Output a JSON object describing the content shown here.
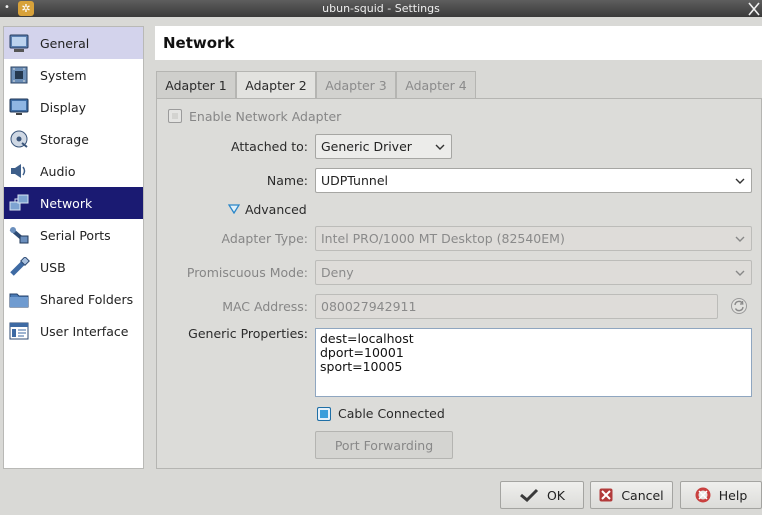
{
  "window": {
    "title": "ubun-squid - Settings"
  },
  "sidebar": {
    "items": [
      {
        "label": "General",
        "icon": "general-icon"
      },
      {
        "label": "System",
        "icon": "system-icon"
      },
      {
        "label": "Display",
        "icon": "display-icon"
      },
      {
        "label": "Storage",
        "icon": "storage-icon"
      },
      {
        "label": "Audio",
        "icon": "audio-icon"
      },
      {
        "label": "Network",
        "icon": "network-icon"
      },
      {
        "label": "Serial Ports",
        "icon": "serial-ports-icon"
      },
      {
        "label": "USB",
        "icon": "usb-icon"
      },
      {
        "label": "Shared Folders",
        "icon": "shared-folders-icon"
      },
      {
        "label": "User Interface",
        "icon": "user-interface-icon"
      }
    ],
    "selected": "Network",
    "hovered": "General"
  },
  "header": {
    "title": "Network"
  },
  "tabs": [
    {
      "label": "Adapter 1",
      "state": "normal"
    },
    {
      "label": "Adapter 2",
      "state": "selected"
    },
    {
      "label": "Adapter 3",
      "state": "disabled"
    },
    {
      "label": "Adapter 4",
      "state": "disabled"
    }
  ],
  "form": {
    "enable_label": "Enable Network Adapter",
    "attached_label": "Attached to:",
    "attached_value": "Generic Driver",
    "name_label": "Name:",
    "name_value": "UDPTunnel",
    "advanced_label": "Advanced",
    "adapter_type_label": "Adapter Type:",
    "adapter_type_value": "Intel PRO/1000 MT Desktop (82540EM)",
    "promiscuous_label": "Promiscuous Mode:",
    "promiscuous_value": "Deny",
    "mac_label": "MAC Address:",
    "mac_value": "080027942911",
    "generic_props_label": "Generic Properties:",
    "generic_props_lines": [
      "dest=localhost",
      "dport=10001",
      "sport=10005"
    ],
    "cable_label": "Cable Connected",
    "cable_checked": true,
    "port_forwarding_label": "Port Forwarding"
  },
  "buttons": {
    "ok": "OK",
    "cancel": "Cancel",
    "help": "Help"
  },
  "colors": {
    "selection": "#1a1a72",
    "hover": "#d3d3ec",
    "checkbox_accent": "#3b9edb"
  }
}
